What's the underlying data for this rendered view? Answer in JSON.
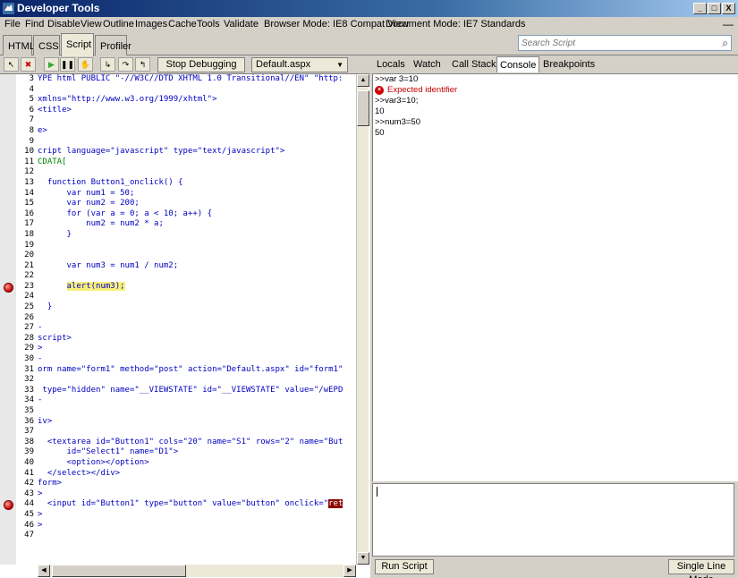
{
  "window": {
    "title": "Developer Tools",
    "minimize_label": "_",
    "maximize_label": "□",
    "close_label": "X"
  },
  "menu": [
    {
      "label": "File"
    },
    {
      "label": "Find"
    },
    {
      "label": "Disable"
    },
    {
      "label": "View"
    },
    {
      "label": "Outline"
    },
    {
      "label": "Images"
    },
    {
      "label": "Cache"
    },
    {
      "label": "Tools"
    },
    {
      "label": "Validate"
    },
    {
      "label": "Browser Mode: IE8 Compat View"
    },
    {
      "label": "Document Mode: IE7 Standards"
    }
  ],
  "panel_close_label": "—",
  "tabs": [
    {
      "label": "HTML"
    },
    {
      "label": "CSS"
    },
    {
      "label": "Script"
    },
    {
      "label": "Profiler"
    }
  ],
  "active_tab": "Script",
  "search": {
    "placeholder": "Search Script",
    "value": ""
  },
  "toolbar": {
    "stop_debugging_label": "Stop Debugging",
    "file_selected": "Default.aspx"
  },
  "right_tabs": [
    {
      "label": "Locals"
    },
    {
      "label": "Watch"
    },
    {
      "label": "Call Stack"
    },
    {
      "label": "Console"
    },
    {
      "label": "Breakpoints"
    }
  ],
  "active_right_tab": "Console",
  "code_lines": [
    {
      "n": "3",
      "text": "YPE html PUBLIC \"-//W3C//DTD XHTML 1.0 Transitional//EN\" \"http:"
    },
    {
      "n": "4",
      "text": ""
    },
    {
      "n": "5",
      "text": "xmlns=\"http://www.w3.org/1999/xhtml\">"
    },
    {
      "n": "6",
      "text": "<title>"
    },
    {
      "n": "7",
      "text": ""
    },
    {
      "n": "8",
      "text": "e>"
    },
    {
      "n": "9",
      "text": ""
    },
    {
      "n": "10",
      "text": "cript language=\"javascript\" type=\"text/javascript\">"
    },
    {
      "n": "11",
      "text": "CDATA[",
      "green": true
    },
    {
      "n": "12",
      "text": ""
    },
    {
      "n": "13",
      "text": "  function Button1_onclick() {"
    },
    {
      "n": "14",
      "text": "      var num1 = 50;"
    },
    {
      "n": "15",
      "text": "      var num2 = 200;"
    },
    {
      "n": "16",
      "text": "      for (var a = 0; a < 10; a++) {"
    },
    {
      "n": "17",
      "text": "          num2 = num2 * a;"
    },
    {
      "n": "18",
      "text": "      }"
    },
    {
      "n": "19",
      "text": ""
    },
    {
      "n": "20",
      "text": ""
    },
    {
      "n": "21",
      "text": "      var num3 = num1 / num2;"
    },
    {
      "n": "22",
      "text": ""
    },
    {
      "n": "23",
      "text": "",
      "pre": "      ",
      "hl": "alert(num3);",
      "breakpoint": true
    },
    {
      "n": "24",
      "text": ""
    },
    {
      "n": "25",
      "text": "  }"
    },
    {
      "n": "26",
      "text": ""
    },
    {
      "n": "27",
      "text": "-"
    },
    {
      "n": "28",
      "text": "script>"
    },
    {
      "n": "29",
      "text": ">"
    },
    {
      "n": "30",
      "text": "-"
    },
    {
      "n": "31",
      "text": "orm name=\"form1\" method=\"post\" action=\"Default.aspx\" id=\"form1\""
    },
    {
      "n": "32",
      "text": ""
    },
    {
      "n": "33",
      "text": " type=\"hidden\" name=\"__VIEWSTATE\" id=\"__VIEWSTATE\" value=\"/wEPD"
    },
    {
      "n": "34",
      "text": "-"
    },
    {
      "n": "35",
      "text": ""
    },
    {
      "n": "36",
      "text": "iv>"
    },
    {
      "n": "37",
      "text": ""
    },
    {
      "n": "38",
      "text": "  <textarea id=\"Button1\" cols=\"20\" name=\"S1\" rows=\"2\" name=\"But"
    },
    {
      "n": "39",
      "text": "      id=\"Select1\" name=\"D1\">"
    },
    {
      "n": "40",
      "text": "      <option></option>"
    },
    {
      "n": "41",
      "text": "  </select></div>"
    },
    {
      "n": "42",
      "text": "form>"
    },
    {
      "n": "43",
      "text": ">"
    },
    {
      "n": "44",
      "text": "",
      "pre": "  <input id=\"Button1\" type=\"button\" value=\"button\" onclick=\"",
      "bp": "ret",
      "breakpoint": true
    },
    {
      "n": "45",
      "text": ">"
    },
    {
      "n": "46",
      "text": ">"
    },
    {
      "n": "47",
      "text": ""
    }
  ],
  "console_lines": [
    {
      "text": ">>var 3=10"
    },
    {
      "text": "Expected identifier",
      "error": true
    },
    {
      "text": ">>var3=10;"
    },
    {
      "text": "10"
    },
    {
      "text": ">>num3=50"
    },
    {
      "text": "50"
    }
  ],
  "console_input": {
    "value": ""
  },
  "buttons": {
    "run_script": "Run Script",
    "single_line_mode": "Single Line Mode"
  },
  "colors": {
    "titlebar": "#0a246a",
    "code_text": "#0000c0",
    "highlight": "#f6f07a",
    "breakpoint": "#c00000",
    "error_text": "#c00000"
  }
}
